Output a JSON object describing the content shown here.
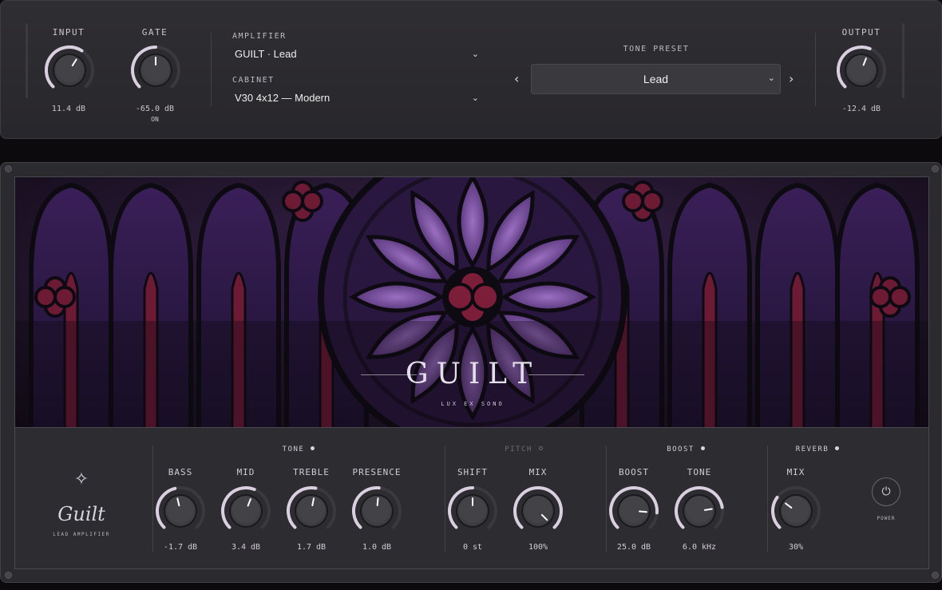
{
  "top": {
    "input": {
      "label": "INPUT",
      "value": "11.4 dB",
      "level": 0.62
    },
    "gate": {
      "label": "GATE",
      "value": "-65.0 dB",
      "status": "ON",
      "level": 0.5
    },
    "amplifier": {
      "label": "AMPLIFIER",
      "value": "GUILT · Lead"
    },
    "cabinet": {
      "label": "CABINET",
      "value": "V30 4x12 — Modern"
    },
    "tone_preset": {
      "label": "TONE PRESET",
      "value": "Lead",
      "prev": "‹",
      "next": "›"
    },
    "output": {
      "label": "OUTPUT",
      "value": "-12.4 dB",
      "level": 0.58
    }
  },
  "amp": {
    "brand": "GUILT",
    "tagline": "LUX EX SONO",
    "logo": {
      "name": "Guilt",
      "subtitle": "LEAD AMPLIFIER",
      "icon": "sparkle-star-icon"
    },
    "sections": {
      "tone": {
        "title": "TONE",
        "enabled": true
      },
      "pitch": {
        "title": "PITCH",
        "enabled": false
      },
      "boost": {
        "title": "BOOST",
        "enabled": true
      },
      "reverb": {
        "title": "REVERB",
        "enabled": true
      }
    },
    "knobs": [
      {
        "id": "bass",
        "label": "BASS",
        "value": "-1.7 dB",
        "level": 0.45
      },
      {
        "id": "mid",
        "label": "MID",
        "value": "3.4 dB",
        "level": 0.58
      },
      {
        "id": "treble",
        "label": "TREBLE",
        "value": "1.7 dB",
        "level": 0.54
      },
      {
        "id": "presence",
        "label": "PRESENCE",
        "value": "1.0 dB",
        "level": 0.52
      },
      {
        "id": "shift",
        "label": "SHIFT",
        "value": "0 st",
        "level": 0.5
      },
      {
        "id": "pitch-mix",
        "label": "MIX",
        "value": "100%",
        "level": 1.0
      },
      {
        "id": "boost",
        "label": "BOOST",
        "value": "25.0 dB",
        "level": 0.85
      },
      {
        "id": "boost-tone",
        "label": "TONE",
        "value": "6.0 kHz",
        "level": 0.8
      },
      {
        "id": "reverb-mix",
        "label": "MIX",
        "value": "30%",
        "level": 0.3
      }
    ],
    "power_label": "POWER"
  },
  "colors": {
    "accent": "#d9cfe0",
    "track": "#3a393e",
    "knob": "#3c3b40"
  }
}
